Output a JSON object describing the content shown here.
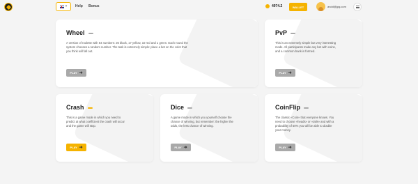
{
  "header": {
    "nav": [
      {
        "label": "Help"
      },
      {
        "label": "Bonus"
      }
    ],
    "balance": "4974.2",
    "wallet_label": "WALLET",
    "user_email": "andd@jpg.com"
  },
  "cards": {
    "wheel": {
      "title": "Wheel",
      "description": "A version of roulette with 54 numbers: 26 black, 17 yellow, 10 red and 1 green. Each round the system chooses a random number. The task is extremely simple: place a bet on the color that you think will fall out.",
      "play_label": "PLAY"
    },
    "pvp": {
      "title": "PvP",
      "description": "This is an extremely simple but very interesting mode. All participants make any bet with coins, and a common bank is formed.",
      "play_label": "PLAY"
    },
    "crash": {
      "title": "Crash",
      "description": "This is a game mode in which you need to predict at what coefficient the crash will occur and the game will stop.",
      "play_label": "PLAY"
    },
    "dice": {
      "title": "Dice",
      "description": "A game mode in which you yourself choose the chance of winning, but remember: the higher the odds, the less chance of winning.",
      "play_label": "PLAY"
    },
    "coinflip": {
      "title": "CoinFlip",
      "description": "The classic «Coin» that everyone knows. You need to choose «heads» or «tails» and with a probability of 50% you will be able to double your money.",
      "play_label": "PLAY"
    }
  },
  "colors": {
    "accent": "#f5b300",
    "muted_button": "#a9a9a9"
  },
  "icons": {
    "logo": "logo-icon",
    "coin": "coin-icon",
    "menu": "menu-icon",
    "arrow": "arrow-right-icon"
  }
}
